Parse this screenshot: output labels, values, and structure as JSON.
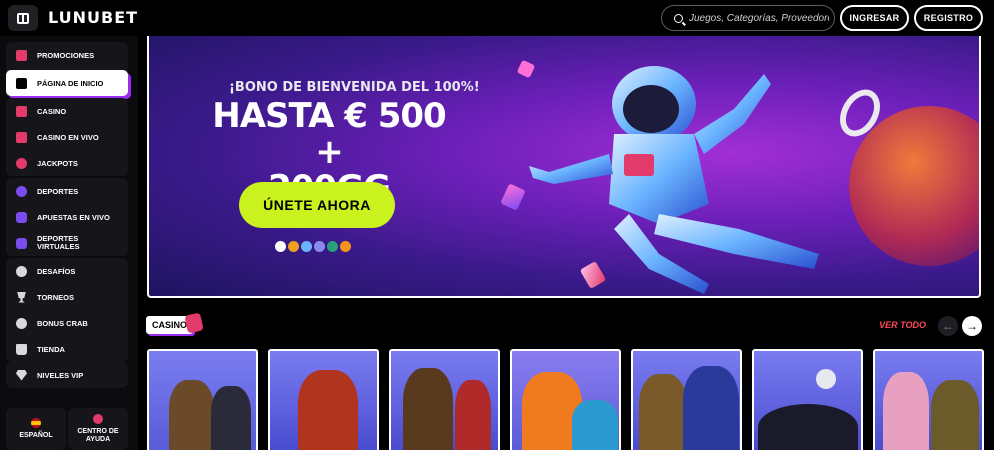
{
  "header": {
    "logo": "LUNUBET",
    "search_placeholder": "Juegos, Categorías, Proveedores",
    "login_label": "INGRESAR",
    "register_label": "REGISTRO"
  },
  "sidebar": {
    "group1": [
      {
        "label": "PROMOCIONES",
        "icon": "gift-icon"
      },
      {
        "label": "PÁGINA DE INICIO",
        "icon": "horse-icon",
        "active": true
      }
    ],
    "group2": [
      {
        "label": "CASINO",
        "icon": "cards-icon"
      },
      {
        "label": "CASINO EN VIVO",
        "icon": "live-cards-icon"
      },
      {
        "label": "JACKPOTS",
        "icon": "cherries-icon"
      }
    ],
    "group3": [
      {
        "label": "DEPORTES",
        "icon": "soccer-ball-icon"
      },
      {
        "label": "APUESTAS EN VIVO",
        "icon": "live-bets-icon"
      },
      {
        "label": "DEPORTES VIRTUALES",
        "icon": "virtual-sports-icon"
      }
    ],
    "group4": [
      {
        "label": "DESAFÍOS",
        "icon": "challenge-icon"
      },
      {
        "label": "TORNEOS",
        "icon": "trophy-icon"
      },
      {
        "label": "BONUS CRAB",
        "icon": "crab-icon"
      },
      {
        "label": "TIENDA",
        "icon": "shop-icon"
      }
    ],
    "group5": [
      {
        "label": "NIVELES VIP",
        "icon": "diamond-icon"
      }
    ],
    "language_label": "ESPAÑOL",
    "help_label": "CENTRO DE AYUDA"
  },
  "hero": {
    "subtitle": "¡BONO DE BIENVENIDA DEL 100%!",
    "title_line1": "HASTA € 500 +",
    "title_line2": "200GG",
    "cta_label": "ÚNETE AHORA",
    "payment_icons": [
      "visa",
      "mastercard",
      "bank",
      "ethereum",
      "tether",
      "bitcoin"
    ]
  },
  "casino": {
    "section_label": "CASINO",
    "view_all_label": "VER TODO",
    "games": [
      {
        "name": "game-1"
      },
      {
        "name": "game-2"
      },
      {
        "name": "game-3"
      },
      {
        "name": "game-4"
      },
      {
        "name": "game-5"
      },
      {
        "name": "game-6"
      },
      {
        "name": "game-7"
      }
    ]
  },
  "colors": {
    "accent_lime": "#c9f21f",
    "accent_purple": "#9b2cf2",
    "accent_red": "#ff4a5a"
  }
}
